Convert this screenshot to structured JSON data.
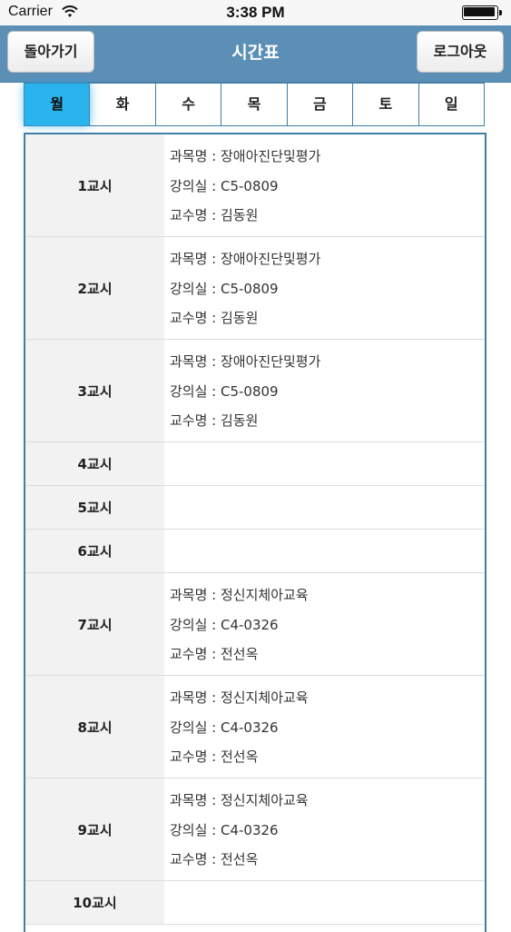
{
  "status_bar": {
    "carrier": "Carrier",
    "time": "3:38 PM"
  },
  "nav": {
    "back_label": "돌아가기",
    "title": "시간표",
    "logout_label": "로그아웃"
  },
  "days": [
    "월",
    "화",
    "수",
    "목",
    "금",
    "토",
    "일"
  ],
  "selected_day": "월",
  "labels": {
    "subject": "과목명 : ",
    "room": "강의실 : ",
    "professor": "교수명 : "
  },
  "periods": [
    {
      "label": "1교시",
      "subject": "장애아진단및평가",
      "room": "C5-0809",
      "professor": "김동원"
    },
    {
      "label": "2교시",
      "subject": "장애아진단및평가",
      "room": "C5-0809",
      "professor": "김동원"
    },
    {
      "label": "3교시",
      "subject": "장애아진단및평가",
      "room": "C5-0809",
      "professor": "김동원"
    },
    {
      "label": "4교시"
    },
    {
      "label": "5교시"
    },
    {
      "label": "6교시"
    },
    {
      "label": "7교시",
      "subject": "정신지체아교육",
      "room": "C4-0326",
      "professor": "전선옥"
    },
    {
      "label": "8교시",
      "subject": "정신지체아교육",
      "room": "C4-0326",
      "professor": "전선옥"
    },
    {
      "label": "9교시",
      "subject": "정신지체아교육",
      "room": "C4-0326",
      "professor": "전선옥"
    },
    {
      "label": "10교시"
    }
  ]
}
